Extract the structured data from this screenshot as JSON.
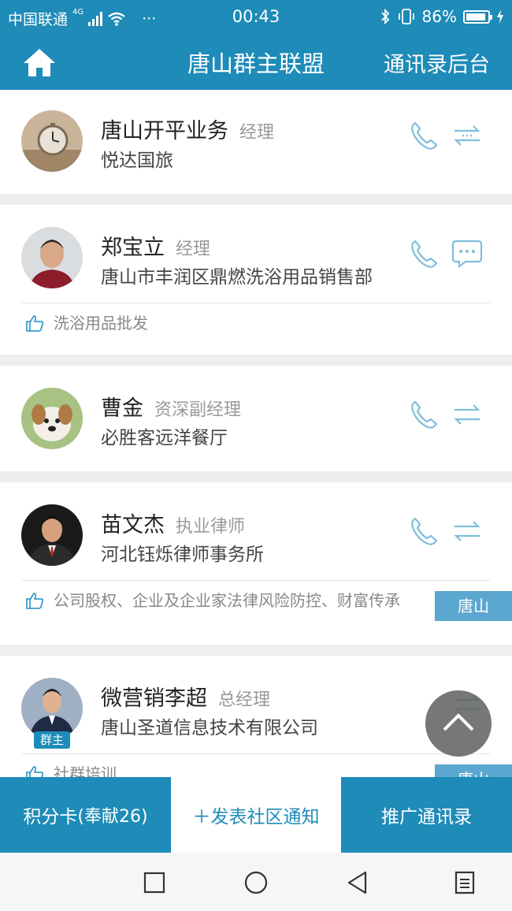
{
  "status_bar": {
    "carrier": "中国联通",
    "network": "4G",
    "more": "···",
    "time": "00:43",
    "battery": "86%"
  },
  "navbar": {
    "title": "唐山群主联盟",
    "admin_link": "通讯录后台"
  },
  "contacts": [
    {
      "name": "唐山开平业务",
      "role": "经理",
      "company": "悦达国旅",
      "tag": "",
      "city": "",
      "action_icon": "transfer-icon"
    },
    {
      "name": "郑宝立",
      "role": "经理",
      "company": "唐山市丰润区鼎燃洗浴用品销售部",
      "tag": "洗浴用品批发",
      "city": "",
      "action_icon": "chat-icon"
    },
    {
      "name": "曹金",
      "role": "资深副经理",
      "company": "必胜客远洋餐厅",
      "tag": "",
      "city": "",
      "action_icon": "transfer-icon"
    },
    {
      "name": "苗文杰",
      "role": "执业律师",
      "company": "河北钰烁律师事务所",
      "tag": "公司股权、企业及企业家法律风险防控、财富传承",
      "city": "唐山",
      "action_icon": "transfer-icon"
    },
    {
      "name": "微营销李超",
      "role": "总经理",
      "company": "唐山圣道信息技术有限公司",
      "tag": "社群培训",
      "city": "唐山",
      "badge": "群主",
      "action_icon": "transfer-icon"
    }
  ],
  "bottom_bar": {
    "points_label": "积分卡",
    "points_detail": "(奉献26)",
    "post_label": "＋发表社区通知",
    "promote_label": "推广通讯录"
  },
  "colors": {
    "brand": "#1e8bb8",
    "badge": "#5ba7cf",
    "icon": "#7fbfdc"
  }
}
